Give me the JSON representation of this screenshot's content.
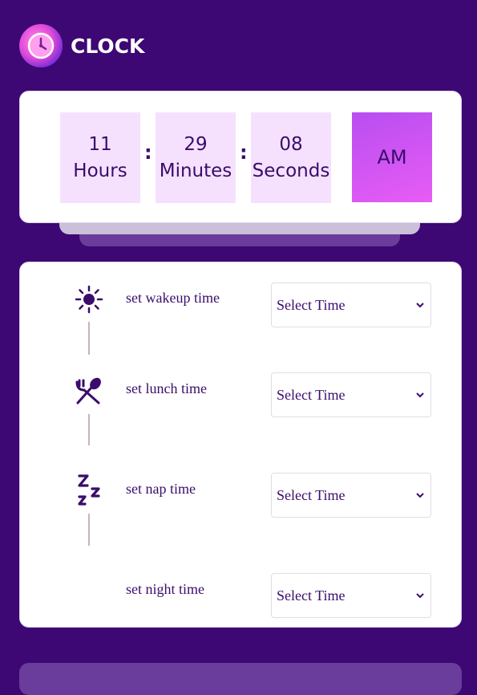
{
  "app": {
    "title": "CLOCK"
  },
  "clock": {
    "hours_value": "11",
    "hours_label": "Hours",
    "minutes_value": "29",
    "minutes_label": "Minutes",
    "seconds_value": "08",
    "seconds_label": "Seconds",
    "separator": ":",
    "period": "AM"
  },
  "schedule": {
    "rows": [
      {
        "label": "set wakeup time",
        "icon": "sun-icon",
        "select_value": "Select Time"
      },
      {
        "label": "set lunch time",
        "icon": "fork-spoon-icon",
        "select_value": "Select Time"
      },
      {
        "label": "set nap time",
        "icon": "sleep-zzz-icon",
        "select_value": "Select Time"
      },
      {
        "label": "set night time",
        "icon": "",
        "select_value": "Select Time"
      }
    ]
  },
  "colors": {
    "background": "#3d0873",
    "text": "#3a0c6b",
    "time_box": "#f5e1fd",
    "accent_gradient_start": "#b84ef0",
    "accent_gradient_end": "#e85cf5"
  }
}
